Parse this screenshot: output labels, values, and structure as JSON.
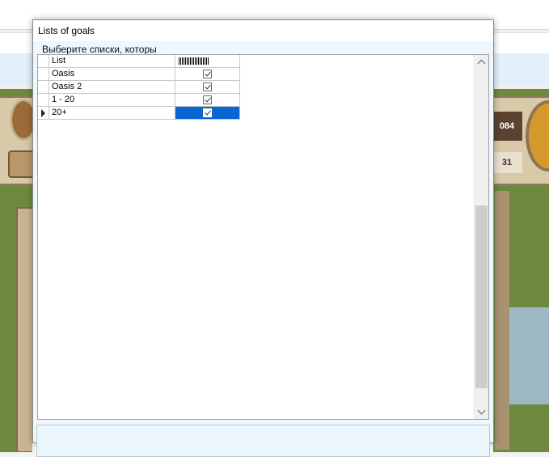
{
  "dialog": {
    "title": "Lists of goals",
    "group_caption": "Выберите списки, которы"
  },
  "grid": {
    "columns": {
      "list": "List"
    },
    "rows": [
      {
        "name": "Oasis",
        "checked": true,
        "selected": false,
        "current": false
      },
      {
        "name": "Oasis 2",
        "checked": true,
        "selected": false,
        "current": false
      },
      {
        "name": "1 - 20",
        "checked": true,
        "selected": false,
        "current": false
      },
      {
        "name": "20+",
        "checked": true,
        "selected": true,
        "current": true
      }
    ]
  },
  "background": {
    "hud_value_1": "084",
    "hud_value_2": "31"
  },
  "colors": {
    "selection": "#0a66d0",
    "client_bg": "#eef7fd"
  },
  "icons": {
    "row_pointer": "triangle-right-icon",
    "scroll_up": "chevron-up-icon",
    "scroll_down": "chevron-down-icon",
    "checkbox": "checkbox-checked-icon"
  }
}
